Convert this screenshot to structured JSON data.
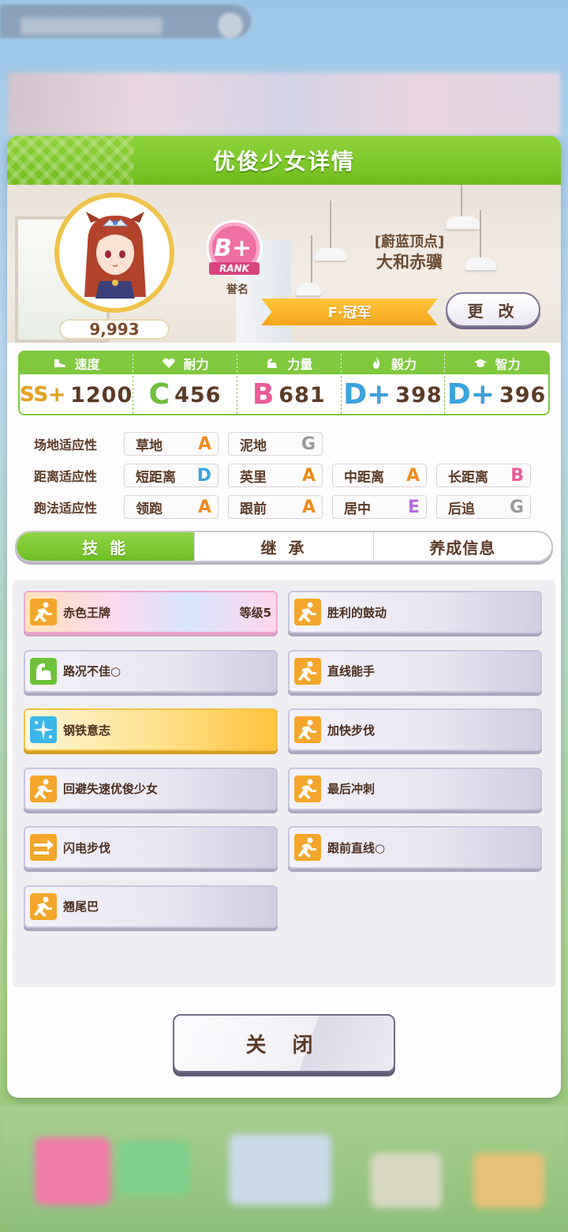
{
  "panel": {
    "title": "优俊少女详情"
  },
  "profile": {
    "score": "9,993",
    "rank": {
      "grade": "B+",
      "label": "RANK"
    },
    "rank_caption": "誉名",
    "epithet": "[蔚蓝顶点]",
    "name": "大和赤骥",
    "title_banner": "F·冠军",
    "change_button": "更 改"
  },
  "stats": [
    {
      "label": "速度",
      "icon": "shoe-icon",
      "grade": "SS+",
      "value": "1200",
      "color": "#e8a318"
    },
    {
      "label": "耐力",
      "icon": "heart-icon",
      "grade": "C",
      "value": "456",
      "color": "#6dc03a"
    },
    {
      "label": "力量",
      "icon": "muscle-icon",
      "grade": "B",
      "value": "681",
      "color": "#ef5b9b"
    },
    {
      "label": "毅力",
      "icon": "flame-icon",
      "grade": "D+",
      "value": "398",
      "color": "#3aa3e0"
    },
    {
      "label": "智力",
      "icon": "grad-cap-icon",
      "grade": "D+",
      "value": "396",
      "color": "#3aa3e0"
    }
  ],
  "aptitude": {
    "rows": [
      {
        "label": "场地适应性",
        "cells": [
          {
            "name": "草地",
            "grade": "A"
          },
          {
            "name": "泥地",
            "grade": "G"
          }
        ]
      },
      {
        "label": "距离适应性",
        "cells": [
          {
            "name": "短距离",
            "grade": "D"
          },
          {
            "name": "英里",
            "grade": "A"
          },
          {
            "name": "中距离",
            "grade": "A"
          },
          {
            "name": "长距离",
            "grade": "B"
          }
        ]
      },
      {
        "label": "跑法适应性",
        "cells": [
          {
            "name": "领跑",
            "grade": "A"
          },
          {
            "name": "跟前",
            "grade": "A"
          },
          {
            "name": "居中",
            "grade": "E"
          },
          {
            "name": "后追",
            "grade": "G"
          }
        ]
      }
    ],
    "grade_colors": {
      "A": "#f08a1c",
      "B": "#ef5b9b",
      "D": "#3aa3e0",
      "E": "#b26de0",
      "G": "#9a9a9a"
    }
  },
  "tabs": [
    {
      "label": "技 能",
      "active": true
    },
    {
      "label": "继 承",
      "active": false
    },
    {
      "label": "养成信息",
      "active": false
    }
  ],
  "skills": {
    "left": [
      {
        "name": "赤色王牌",
        "level": "等级5",
        "style": "rainbow",
        "icon": "runner-icon"
      },
      {
        "name": "路况不佳○",
        "level": "",
        "style": "normal",
        "icon": "green-muscle-icon"
      },
      {
        "name": "钢铁意志",
        "level": "",
        "style": "gold",
        "icon": "sparkle-icon"
      },
      {
        "name": "回避失速优俊少女",
        "level": "",
        "style": "normal",
        "icon": "runner-icon"
      },
      {
        "name": "闪电步伐",
        "level": "",
        "style": "normal",
        "icon": "arrow-right-icon"
      },
      {
        "name": "翘尾巴",
        "level": "",
        "style": "normal",
        "icon": "runner-icon"
      }
    ],
    "right": [
      {
        "name": "胜利的鼓动",
        "level": "",
        "style": "normal",
        "icon": "runner-icon"
      },
      {
        "name": "直线能手",
        "level": "",
        "style": "normal",
        "icon": "runner-icon"
      },
      {
        "name": "加快步伐",
        "level": "",
        "style": "normal",
        "icon": "runner-icon"
      },
      {
        "name": "最后冲刺",
        "level": "",
        "style": "normal",
        "icon": "runner-icon"
      },
      {
        "name": "跟前直线○",
        "level": "",
        "style": "normal",
        "icon": "runner-icon"
      }
    ]
  },
  "close_button": "关 闭"
}
